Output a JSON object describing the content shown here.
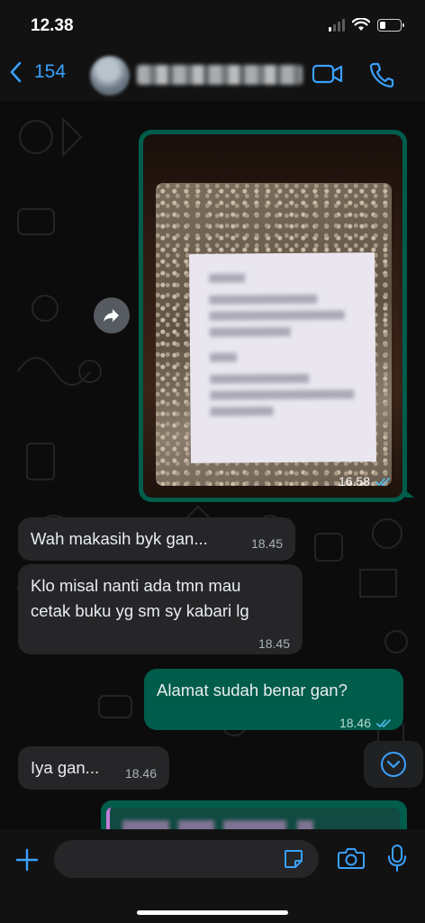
{
  "status_bar": {
    "time": "12.38",
    "signal_bars_active": 1,
    "battery_level": 0.3
  },
  "header": {
    "back_count": "154",
    "contact_name": ""
  },
  "colors": {
    "accent": "#3aa1ff",
    "outgoing_bubble": "#005c4b",
    "incoming_bubble": "#262628",
    "read_ticks": "#53bdeb"
  },
  "messages": [
    {
      "type": "image",
      "direction": "outgoing",
      "time": "16.58",
      "status": "read"
    },
    {
      "type": "text",
      "direction": "incoming",
      "text": "Wah makasih byk gan...",
      "time": "18.45"
    },
    {
      "type": "text",
      "direction": "incoming",
      "text_line1": "Klo misal nanti ada tmn mau",
      "text_line2": "cetak buku yg sm sy kabari lg",
      "time": "18.45"
    },
    {
      "type": "text",
      "direction": "outgoing",
      "text": "Alamat sudah benar gan?",
      "time": "18.46",
      "status": "read"
    },
    {
      "type": "text",
      "direction": "incoming",
      "text": "Iya gan...",
      "time": "18.46"
    }
  ],
  "composer": {
    "placeholder": ""
  },
  "icons": [
    "chevron-left-icon",
    "video-call-icon",
    "phone-icon",
    "forward-icon",
    "double-check-icon",
    "chevron-down-icon",
    "plus-icon",
    "sticker-icon",
    "camera-icon",
    "microphone-icon"
  ]
}
